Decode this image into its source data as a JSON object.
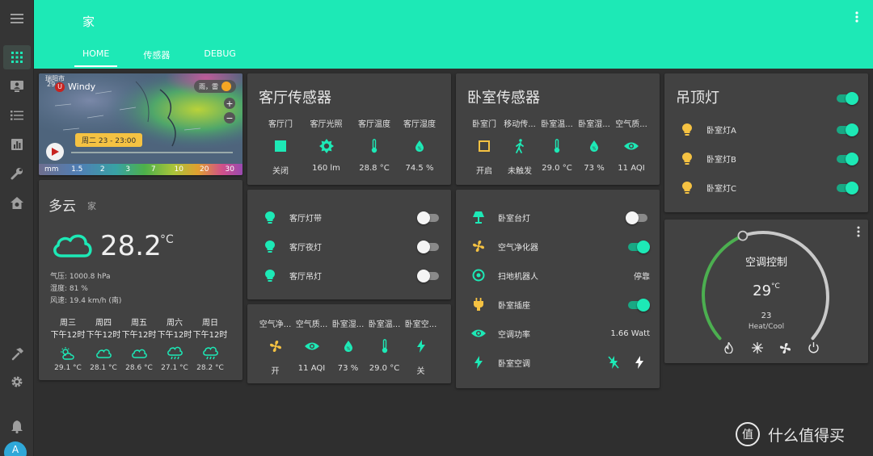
{
  "header": {
    "title": "家",
    "tabs": [
      {
        "label": "HOME",
        "active": true
      },
      {
        "label": "传感器",
        "active": false
      },
      {
        "label": "DEBUG",
        "active": false
      }
    ]
  },
  "colors": {
    "accent": "#1de9b6",
    "icon": "#1de9b6",
    "bulb_on": "#f5c242",
    "card": "#424242",
    "background": "#2f2f2f"
  },
  "sidebar": {
    "items": [
      {
        "icon": "menu-icon"
      },
      {
        "icon": "dashboard-icon",
        "active": true
      },
      {
        "icon": "account-box-icon"
      },
      {
        "icon": "list-icon"
      },
      {
        "icon": "chart-icon"
      },
      {
        "icon": "wrench-icon"
      },
      {
        "icon": "home-gear-icon"
      },
      {
        "icon": "hammer-icon"
      },
      {
        "icon": "settings-icon"
      },
      {
        "icon": "bell-icon"
      }
    ],
    "avatar": "A"
  },
  "map": {
    "top_text": "瑞阳市",
    "north_label": "29",
    "logo": "Windy",
    "logo_badge": "U",
    "tag": "雨，雷",
    "time": "周二 23 - 23:00",
    "zoom_in": "+",
    "zoom_out": "−",
    "scale": [
      "mm",
      "1.5",
      "2",
      "3",
      "7",
      "10",
      "20",
      "30"
    ]
  },
  "weather": {
    "condition": "多云",
    "location": "家",
    "temperature": "28.2",
    "unit": "°C",
    "pressure": "气压: 1000.8 hPa",
    "humidity": "湿度: 81 %",
    "wind": "风速: 19.4 km/h (南)",
    "forecast": [
      {
        "day": "周三",
        "time": "下午12时",
        "icon": "partly-cloudy-icon",
        "temp": "29.1 °C"
      },
      {
        "day": "周四",
        "time": "下午12时",
        "icon": "cloudy-icon",
        "temp": "28.1 °C"
      },
      {
        "day": "周五",
        "time": "下午12时",
        "icon": "cloudy-icon",
        "temp": "28.6 °C"
      },
      {
        "day": "周六",
        "time": "下午12时",
        "icon": "rainy-icon",
        "temp": "27.1 °C"
      },
      {
        "day": "周日",
        "time": "下午12时",
        "icon": "rainy-icon",
        "temp": "28.2 °C"
      }
    ]
  },
  "living_sensors": {
    "title": "客厅传感器",
    "items": [
      {
        "name": "客厅门",
        "icon": "door-closed-icon",
        "value": "关闭"
      },
      {
        "name": "客厅光照",
        "icon": "brightness-icon",
        "value": "160 lm"
      },
      {
        "name": "客厅温度",
        "icon": "thermometer-icon",
        "value": "28.8 °C"
      },
      {
        "name": "客厅湿度",
        "icon": "water-drop-icon",
        "value": "74.5 %"
      }
    ]
  },
  "bedroom_sensors": {
    "title": "卧室传感器",
    "items": [
      {
        "name": "卧室门",
        "icon": "door-open-icon",
        "value": "开启"
      },
      {
        "name": "移动传...",
        "icon": "walk-icon",
        "value": "未触发"
      },
      {
        "name": "卧室温...",
        "icon": "thermometer-icon",
        "value": "29.0 °C"
      },
      {
        "name": "卧室湿...",
        "icon": "water-drop-icon",
        "value": "73 %"
      },
      {
        "name": "空气质...",
        "icon": "eye-icon",
        "value": "11 AQI"
      }
    ]
  },
  "ceiling": {
    "title": "吊顶灯",
    "master": true,
    "rows": [
      {
        "label": "卧室灯A",
        "on": true
      },
      {
        "label": "卧室灯B",
        "on": true
      },
      {
        "label": "卧室灯C",
        "on": true
      }
    ]
  },
  "living_lights": {
    "rows": [
      {
        "label": "客厅灯带",
        "on": false
      },
      {
        "label": "客厅夜灯",
        "on": false
      },
      {
        "label": "客厅吊灯",
        "on": false
      }
    ]
  },
  "bedroom_devices": {
    "rows": [
      {
        "label": "卧室台灯",
        "icon": "lamp-icon",
        "type": "toggle",
        "on": false
      },
      {
        "label": "空气净化器",
        "icon": "fan-icon",
        "type": "toggle",
        "on": true
      },
      {
        "label": "扫地机器人",
        "icon": "robot-vacuum-icon",
        "type": "state",
        "state": "停靠"
      },
      {
        "label": "卧室插座",
        "icon": "power-plug-icon",
        "type": "toggle",
        "on": true
      },
      {
        "label": "空调功率",
        "icon": "eye-icon",
        "type": "state",
        "state": "1.66 Watt"
      },
      {
        "label": "卧室空调",
        "icon": "flash-icon",
        "type": "buttons"
      }
    ]
  },
  "glance_mix": {
    "items": [
      {
        "name": "空气净...",
        "icon": "fan-icon",
        "value": "开"
      },
      {
        "name": "空气质...",
        "icon": "eye-icon",
        "value": "11 AQI"
      },
      {
        "name": "卧室湿...",
        "icon": "water-drop-icon",
        "value": "73 %"
      },
      {
        "name": "卧室温...",
        "icon": "thermometer-icon",
        "value": "29.0 °C"
      },
      {
        "name": "卧室空...",
        "icon": "flash-icon",
        "value": "关"
      }
    ]
  },
  "thermostat": {
    "name": "空调控制",
    "current_temp": "29",
    "unit": "°C",
    "setpoint": "23",
    "mode": "Heat/Cool"
  },
  "watermark": {
    "logo": "值",
    "text": "什么值得买"
  }
}
